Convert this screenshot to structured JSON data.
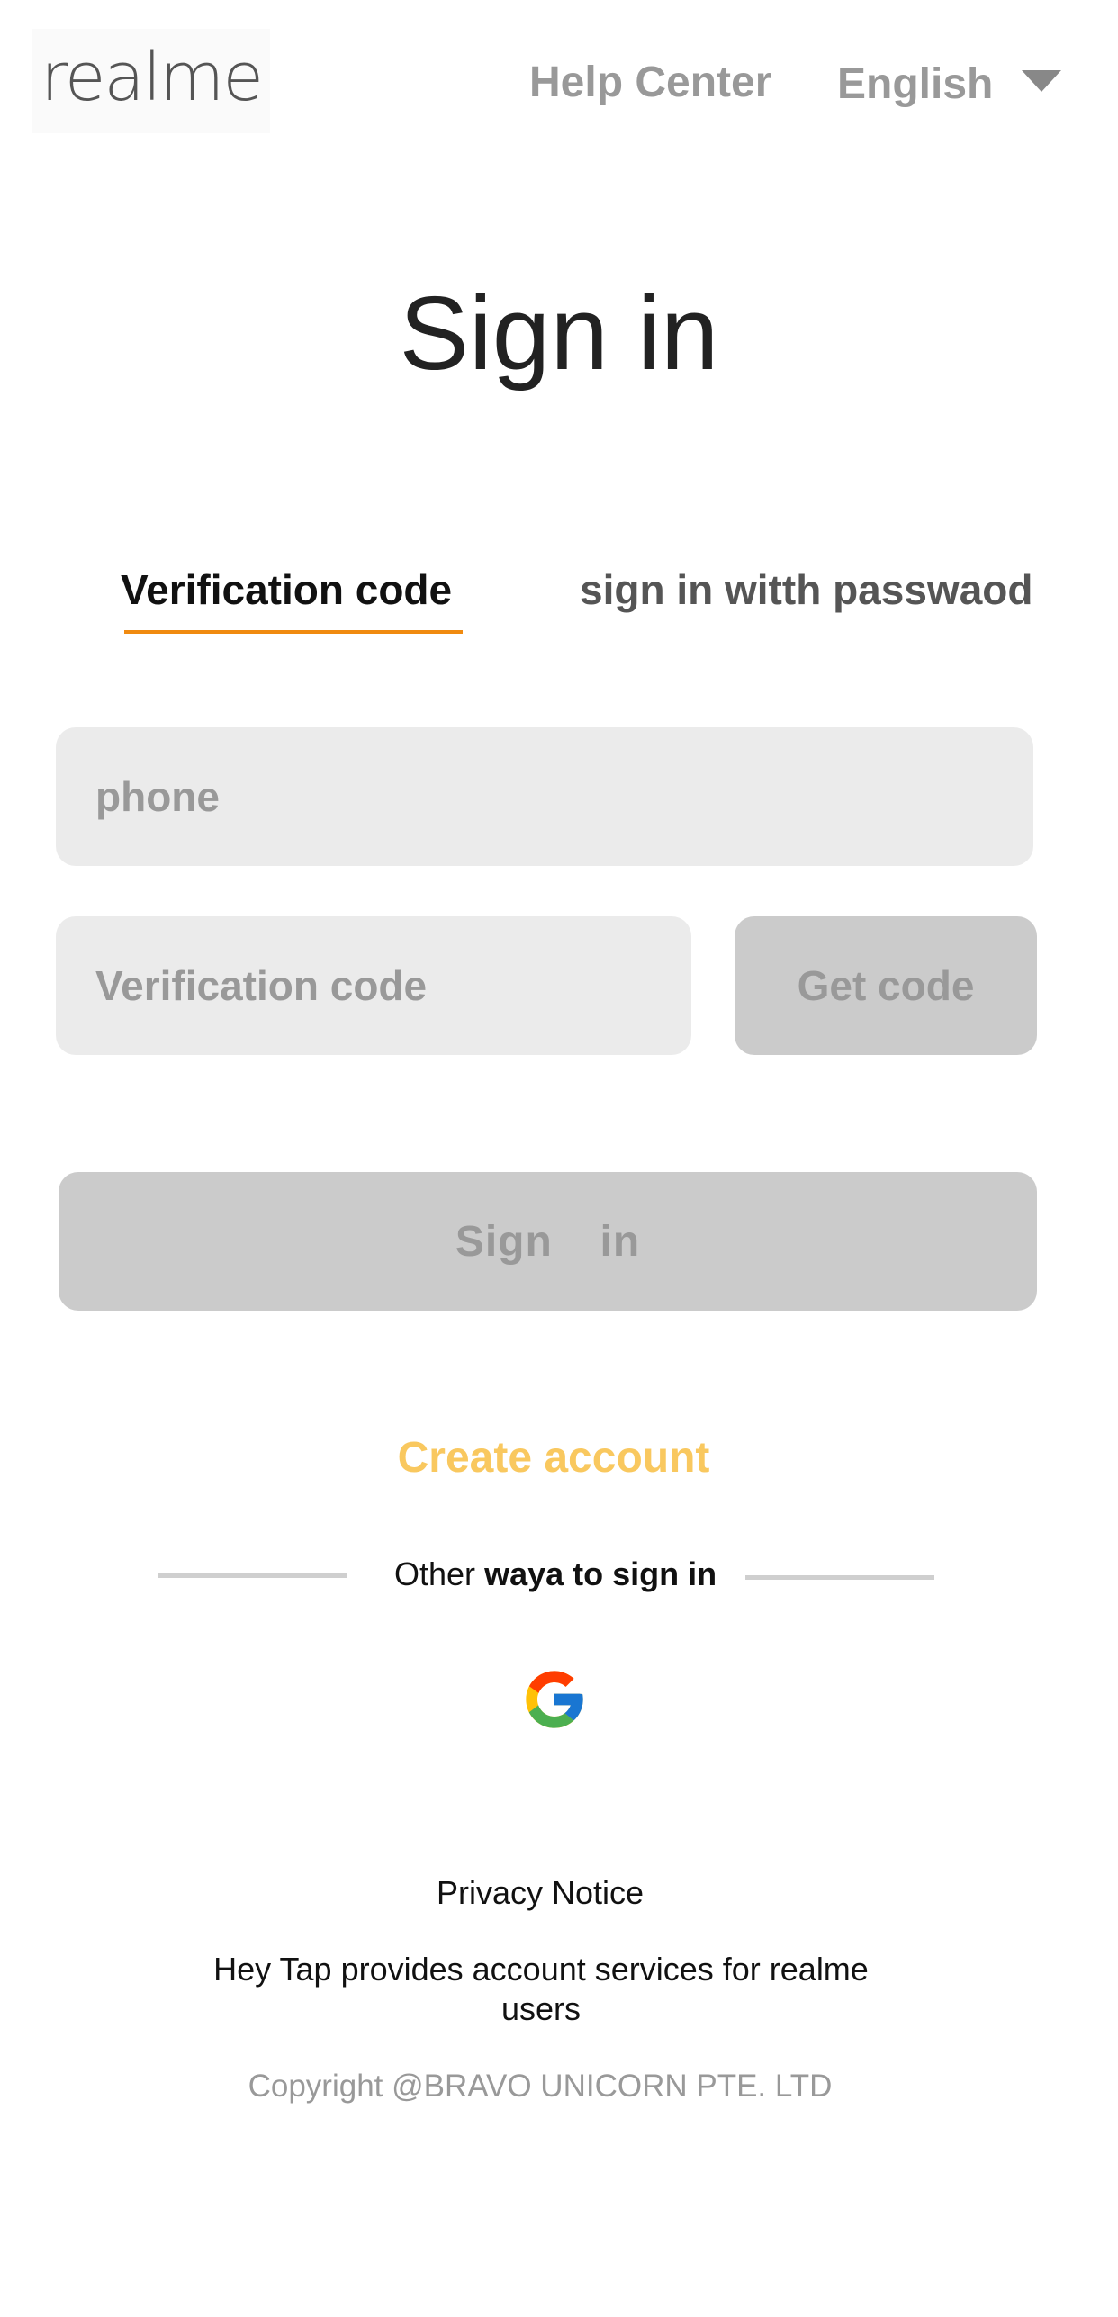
{
  "header": {
    "logo_text": "realme",
    "help_center_label": "Help Center",
    "language_selected": "English"
  },
  "main": {
    "title": "Sign in",
    "tabs": [
      {
        "label": "Verification code",
        "active": true
      },
      {
        "label": "sign in witth passwaod",
        "active": false
      }
    ],
    "phone_placeholder": "phone",
    "code_placeholder": "Verification code",
    "get_code_label": "Get code",
    "sign_in_label": "Sign  in",
    "create_account_label": "Create account",
    "other_ways_prefix": "Other",
    "other_ways_bold": "waya to sign in",
    "google_icon": "google-icon"
  },
  "footer": {
    "privacy_notice": "Privacy Notice",
    "provides_text": "Hey Tap provides account services for realme users",
    "copyright": "Copyright @BRAVO UNICORN PTE. LTD"
  },
  "colors": {
    "accent_orange": "#f08a10",
    "create_account": "#f9c85f",
    "input_bg": "#ebebeb",
    "disabled_button": "#cbcbcb",
    "muted_text": "#999999"
  }
}
